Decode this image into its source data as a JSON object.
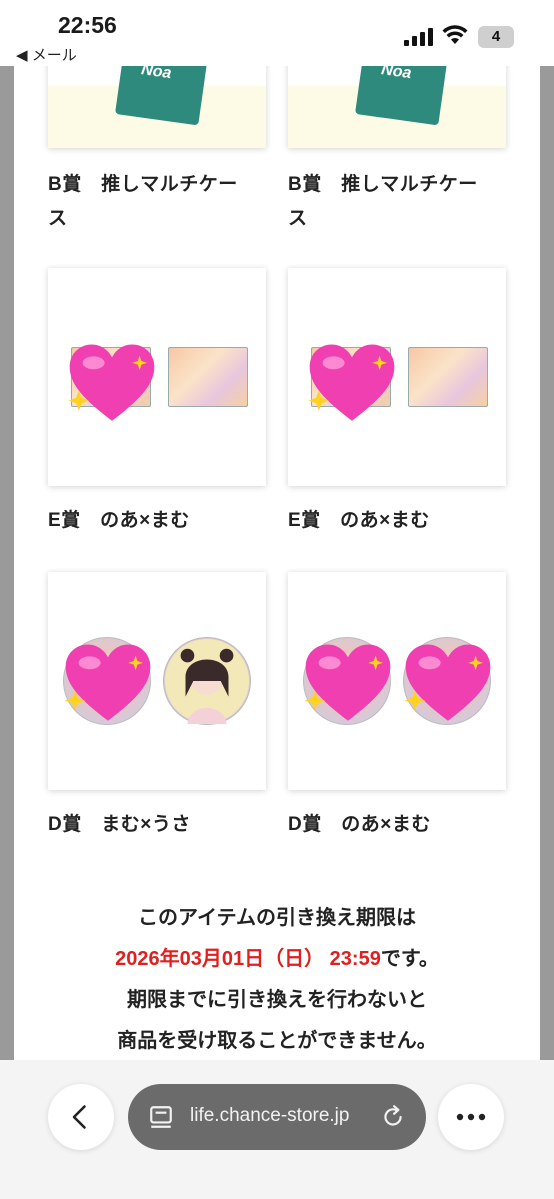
{
  "status_bar": {
    "time": "22:56",
    "back_app": "◀ メール",
    "battery": "4"
  },
  "items": [
    {
      "label": "B賞　推しマルチケース",
      "label_line1": "B賞　推しマルチケー",
      "label_line2": "ス",
      "kind": "package",
      "package_text": "Noa"
    },
    {
      "label": "B賞　推しマルチケース",
      "label_line1": "B賞　推しマルチケー",
      "label_line2": "ス",
      "kind": "package",
      "package_text": "Noa"
    },
    {
      "label": "E賞　のあ×まむ",
      "kind": "acrylic-pair"
    },
    {
      "label": "E賞　のあ×まむ",
      "kind": "acrylic-pair"
    },
    {
      "label": "D賞　まむ×うさ",
      "kind": "badge-pair-one-hidden"
    },
    {
      "label": "D賞　のあ×まむ",
      "kind": "badge-pair-both-hidden"
    }
  ],
  "notice": {
    "line1": "このアイテムの引き換え期限は",
    "deadline": "2026年03月01日（日） 23:59",
    "line2_suffix": "です。",
    "line3": "期限までに引き換えを行わないと",
    "line4": "商品を受け取ることができません。",
    "deadline_color": "#e02020"
  },
  "browser": {
    "url": "life.chance-store.jp",
    "back_icon": "chevron-left-icon",
    "tabs_icon": "page-menu-icon",
    "reload_icon": "reload-icon",
    "more_icon": "more-icon"
  }
}
